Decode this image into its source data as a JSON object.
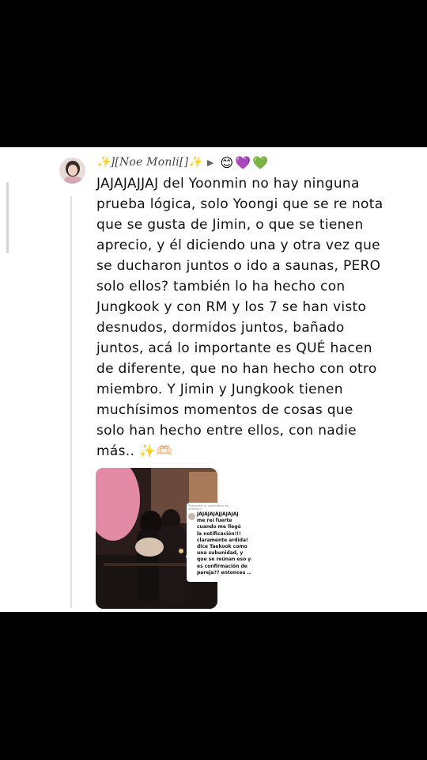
{
  "comment": {
    "username": "Noe Monli",
    "username_prefix": "✨][",
    "username_suffix": "[]✨",
    "reactions": [
      "😊",
      "💜",
      "💚"
    ],
    "text_lines": [
      "JAJAJAJJAJ del Yoonmin no hay ninguna",
      "prueba lógica, solo Yoongi que se re nota",
      "que se gusta de Jimin, o que se tienen",
      "aprecio, y él diciendo una y otra vez que",
      "se ducharon juntos o ido a saunas, PERO",
      "solo ellos? también lo ha hecho con",
      "Jungkook y con RM y los 7 se han visto",
      "desnudos, dormidos juntos, bañado",
      "juntos, acá lo importante es QUÉ hacen",
      "de diferente, que no han hecho con otro",
      "miembro. Y Jimin y Jungkook tienen",
      "muchísimos momentos de cosas que",
      "solo han hecho entre ellos, con nadie",
      "más.. ✨🫶🏻"
    ]
  },
  "reply_preview": {
    "header": "Responder al comentario de",
    "header_line2": "noemonli",
    "text_lines": [
      "JAJAJAJAJJAJAJAJ",
      "me reí fuerte",
      "cuando me llegó",
      "la notificación!!!",
      "claramente ardida!",
      "dice Taekook como",
      "una subunidad, y",
      "que se reúnan eso ya",
      "es confirmación de",
      "pareja?? entonces ..."
    ]
  },
  "colors": {
    "background": "#000000",
    "card": "#ffffff",
    "text": "#111111"
  }
}
